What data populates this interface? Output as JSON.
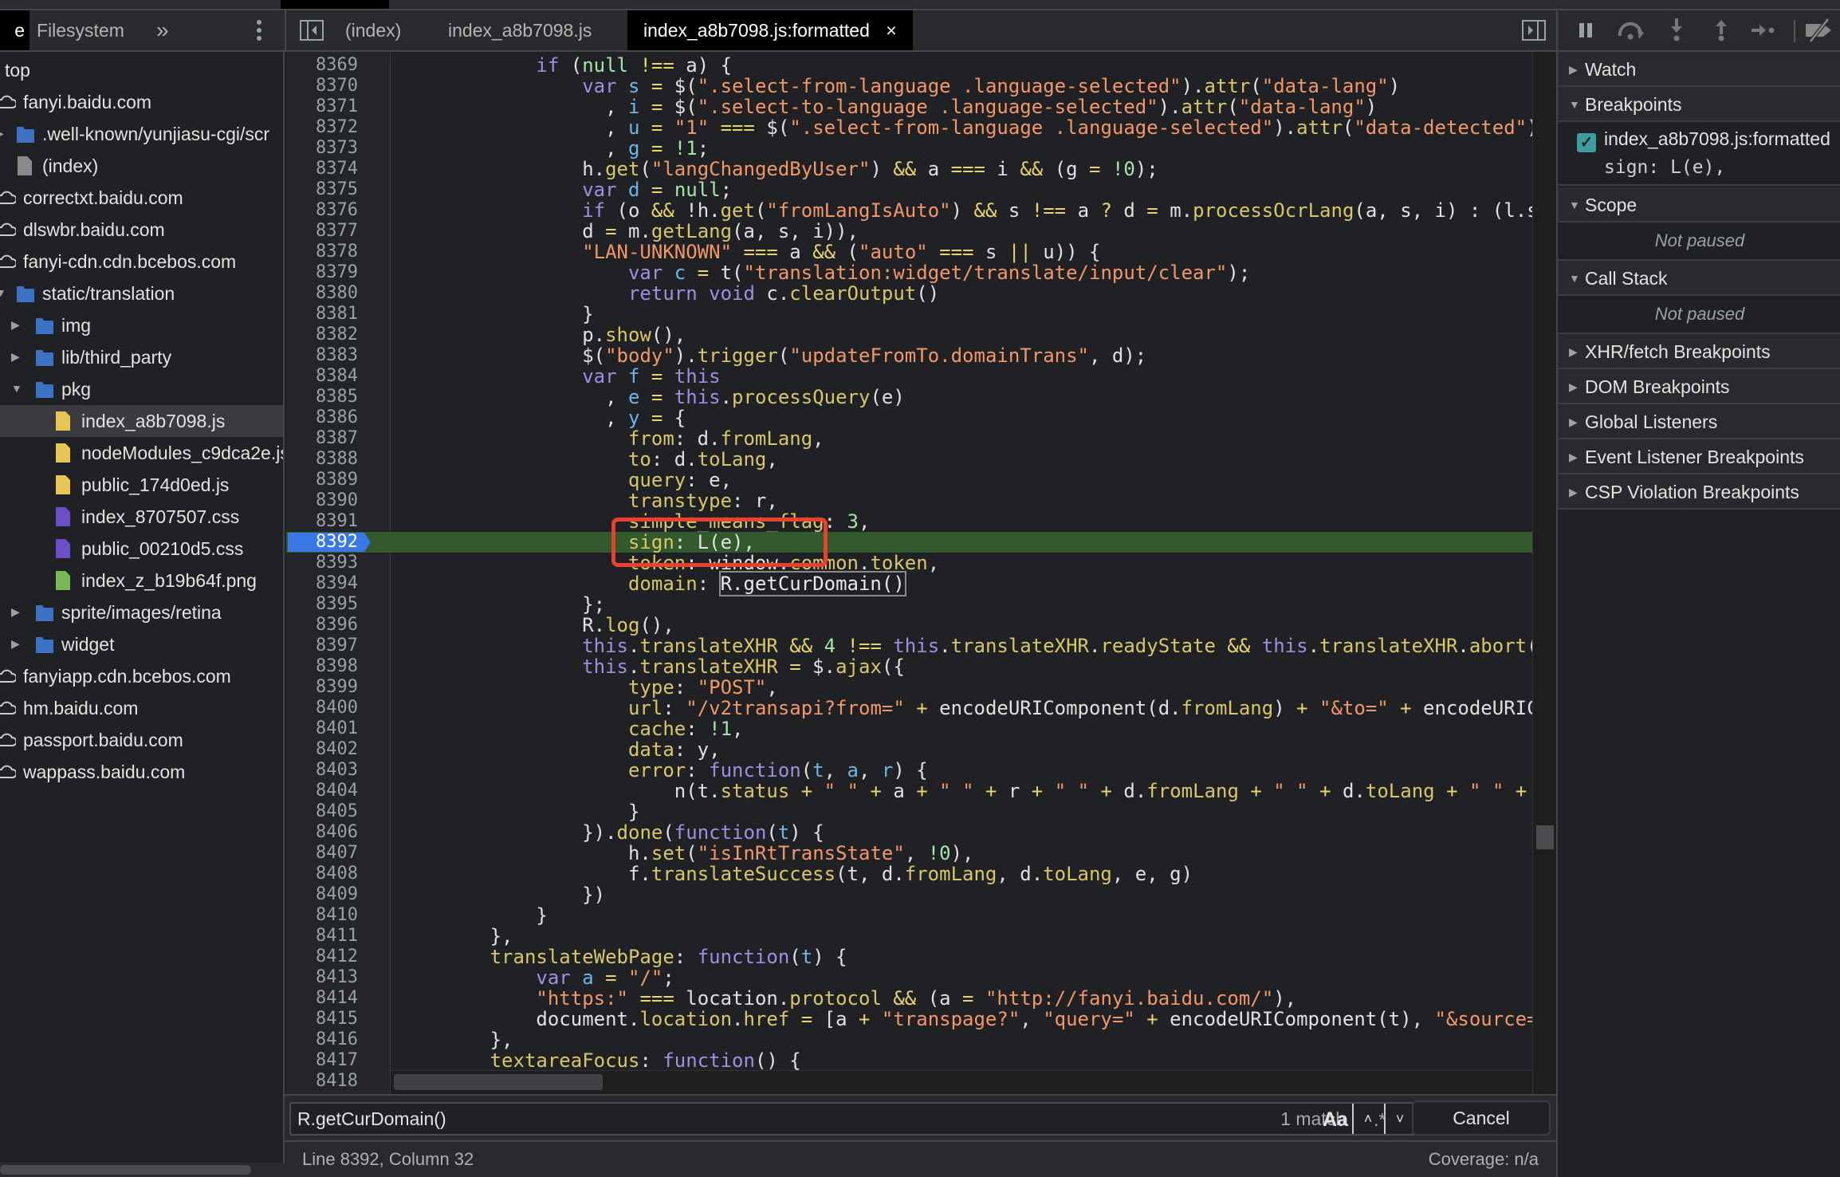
{
  "left_tabs": {
    "cut_tab": "e",
    "filesystem": "Filesystem",
    "more": "»"
  },
  "editor_tabs": [
    {
      "label": "(index)",
      "active": false
    },
    {
      "label": "index_a8b7098.js",
      "active": false
    },
    {
      "label": "index_a8b7098.js:formatted",
      "active": true,
      "close": "×"
    }
  ],
  "tree": [
    {
      "label": "top",
      "depth": 0,
      "icon": "none"
    },
    {
      "label": "fanyi.baidu.com",
      "depth": 1,
      "icon": "cloud"
    },
    {
      "label": ".well-known/yunjiasu-cgi/scr",
      "depth": 2,
      "icon": "folder",
      "arrow": "right"
    },
    {
      "label": "(index)",
      "depth": 2,
      "icon": "file-gray"
    },
    {
      "label": "correctxt.baidu.com",
      "depth": 1,
      "icon": "cloud"
    },
    {
      "label": "dlswbr.baidu.com",
      "depth": 1,
      "icon": "cloud"
    },
    {
      "label": "fanyi-cdn.cdn.bcebos.com",
      "depth": 1,
      "icon": "cloud"
    },
    {
      "label": "static/translation",
      "depth": 2,
      "icon": "folder",
      "arrow": "down"
    },
    {
      "label": "img",
      "depth": 3,
      "icon": "folder",
      "arrow": "right"
    },
    {
      "label": "lib/third_party",
      "depth": 3,
      "icon": "folder",
      "arrow": "right"
    },
    {
      "label": "pkg",
      "depth": 3,
      "icon": "folder",
      "arrow": "down"
    },
    {
      "label": "index_a8b7098.js",
      "depth": 4,
      "icon": "file-js",
      "selected": true
    },
    {
      "label": "nodeModules_c9dca2e.js",
      "depth": 4,
      "icon": "file-js"
    },
    {
      "label": "public_174d0ed.js",
      "depth": 4,
      "icon": "file-js"
    },
    {
      "label": "index_8707507.css",
      "depth": 4,
      "icon": "file-css"
    },
    {
      "label": "public_00210d5.css",
      "depth": 4,
      "icon": "file-css"
    },
    {
      "label": "index_z_b19b64f.png",
      "depth": 4,
      "icon": "file-img"
    },
    {
      "label": "sprite/images/retina",
      "depth": 3,
      "icon": "folder",
      "arrow": "right"
    },
    {
      "label": "widget",
      "depth": 3,
      "icon": "folder",
      "arrow": "right"
    },
    {
      "label": "fanyiapp.cdn.bcebos.com",
      "depth": 1,
      "icon": "cloud"
    },
    {
      "label": "hm.baidu.com",
      "depth": 1,
      "icon": "cloud"
    },
    {
      "label": "passport.baidu.com",
      "depth": 1,
      "icon": "cloud"
    },
    {
      "label": "wappass.baidu.com",
      "depth": 1,
      "icon": "cloud"
    }
  ],
  "colors": {
    "folder": "#3b72c4",
    "file-js": "#e6c553",
    "file-css": "#6a4fc8",
    "file-img": "#7bb65a",
    "file-gray": "#8a8a8a",
    "breakpoint_line": "#335a2c",
    "annotation": "#e8412c"
  },
  "breakpoint_line": "8392",
  "code": [
    {
      "n": "8369",
      "t": [
        "            ",
        [
          "k",
          "if"
        ],
        " (",
        [
          "n",
          "null"
        ],
        " ",
        [
          "o",
          "!=="
        ],
        " a) {"
      ]
    },
    {
      "n": "8370",
      "t": [
        "                ",
        [
          "k",
          "var"
        ],
        " ",
        [
          "v",
          "s"
        ],
        " ",
        [
          "o",
          "="
        ],
        " $(",
        [
          "s",
          "\".select-from-language .language-selected\""
        ],
        ").",
        [
          "p",
          "attr"
        ],
        "(",
        [
          "s",
          "\"data-lang\""
        ],
        ")"
      ]
    },
    {
      "n": "8371",
      "t": [
        "                  , ",
        [
          "v",
          "i"
        ],
        " ",
        [
          "o",
          "="
        ],
        " $(",
        [
          "s",
          "\".select-to-language .language-selected\""
        ],
        ").",
        [
          "p",
          "attr"
        ],
        "(",
        [
          "s",
          "\"data-lang\""
        ],
        ")"
      ]
    },
    {
      "n": "8372",
      "t": [
        "                  , ",
        [
          "v",
          "u"
        ],
        " ",
        [
          "o",
          "="
        ],
        " ",
        [
          "s",
          "\"1\""
        ],
        " ",
        [
          "o",
          "==="
        ],
        " $(",
        [
          "s",
          "\".select-from-language .language-selected\""
        ],
        ").",
        [
          "p",
          "attr"
        ],
        "(",
        [
          "s",
          "\"data-detected\""
        ],
        ")"
      ]
    },
    {
      "n": "8373",
      "t": [
        "                  , ",
        [
          "v",
          "g"
        ],
        " ",
        [
          "o",
          "="
        ],
        " ",
        [
          "n",
          "!1"
        ],
        ";"
      ]
    },
    {
      "n": "8374",
      "t": [
        "                h.",
        [
          "p",
          "get"
        ],
        "(",
        [
          "s",
          "\"langChangedByUser\""
        ],
        ") ",
        [
          "o",
          "&&"
        ],
        " a ",
        [
          "o",
          "==="
        ],
        " i ",
        [
          "o",
          "&&"
        ],
        " (g ",
        [
          "o",
          "="
        ],
        " ",
        [
          "n",
          "!0"
        ],
        ");"
      ]
    },
    {
      "n": "8375",
      "t": [
        "                ",
        [
          "k",
          "var"
        ],
        " ",
        [
          "v",
          "d"
        ],
        " ",
        [
          "o",
          "="
        ],
        " ",
        [
          "n",
          "null"
        ],
        ";"
      ]
    },
    {
      "n": "8376",
      "t": [
        "                ",
        [
          "k",
          "if"
        ],
        " (o ",
        [
          "o",
          "&&"
        ],
        " !h.",
        [
          "p",
          "get"
        ],
        "(",
        [
          "s",
          "\"fromLangIsAuto\""
        ],
        ") ",
        [
          "o",
          "&&"
        ],
        " s ",
        [
          "o",
          "!=="
        ],
        " a ",
        [
          "o",
          "?"
        ],
        " d ",
        [
          "o",
          "="
        ],
        " m.",
        [
          "p",
          "processOcrLang"
        ],
        "(a, s, i) : (l.s"
      ]
    },
    {
      "n": "8377",
      "t": [
        "                d ",
        [
          "o",
          "="
        ],
        " m.",
        [
          "p",
          "getLang"
        ],
        "(a, s, i)),"
      ]
    },
    {
      "n": "8378",
      "t": [
        "                ",
        [
          "s",
          "\"LAN-UNKNOWN\""
        ],
        " ",
        [
          "o",
          "==="
        ],
        " a ",
        [
          "o",
          "&&"
        ],
        " (",
        [
          "s",
          "\"auto\""
        ],
        " ",
        [
          "o",
          "==="
        ],
        " s ",
        [
          "o",
          "||"
        ],
        " u)) {"
      ]
    },
    {
      "n": "8379",
      "t": [
        "                    ",
        [
          "k",
          "var"
        ],
        " ",
        [
          "v",
          "c"
        ],
        " ",
        [
          "o",
          "="
        ],
        " t(",
        [
          "s",
          "\"translation:widget/translate/input/clear\""
        ],
        ");"
      ]
    },
    {
      "n": "8380",
      "t": [
        "                    ",
        [
          "k",
          "return"
        ],
        " ",
        [
          "k",
          "void"
        ],
        " c.",
        [
          "p",
          "clearOutput"
        ],
        "()"
      ]
    },
    {
      "n": "8381",
      "t": [
        "                }"
      ]
    },
    {
      "n": "8382",
      "t": [
        "                p.",
        [
          "p",
          "show"
        ],
        "(),"
      ]
    },
    {
      "n": "8383",
      "t": [
        "                $(",
        [
          "s",
          "\"body\""
        ],
        ").",
        [
          "p",
          "trigger"
        ],
        "(",
        [
          "s",
          "\"updateFromTo.domainTrans\""
        ],
        ", d);"
      ]
    },
    {
      "n": "8384",
      "t": [
        "                ",
        [
          "k",
          "var"
        ],
        " ",
        [
          "v",
          "f"
        ],
        " ",
        [
          "o",
          "="
        ],
        " ",
        [
          "k",
          "this"
        ]
      ]
    },
    {
      "n": "8385",
      "t": [
        "                  , ",
        [
          "v",
          "e"
        ],
        " ",
        [
          "o",
          "="
        ],
        " ",
        [
          "k",
          "this"
        ],
        ".",
        [
          "p",
          "processQuery"
        ],
        "(e)"
      ]
    },
    {
      "n": "8386",
      "t": [
        "                  , ",
        [
          "v",
          "y"
        ],
        " ",
        [
          "o",
          "="
        ],
        " {"
      ]
    },
    {
      "n": "8387",
      "t": [
        "                    ",
        [
          "p",
          "from"
        ],
        ": d.",
        [
          "p",
          "fromLang"
        ],
        ","
      ]
    },
    {
      "n": "8388",
      "t": [
        "                    ",
        [
          "p",
          "to"
        ],
        ": d.",
        [
          "p",
          "toLang"
        ],
        ","
      ]
    },
    {
      "n": "8389",
      "t": [
        "                    ",
        [
          "p",
          "query"
        ],
        ": e,"
      ]
    },
    {
      "n": "8390",
      "t": [
        "                    ",
        [
          "p",
          "transtype"
        ],
        ": r,"
      ]
    },
    {
      "n": "8391",
      "t": [
        "                    ",
        [
          "p",
          "simple_means_flag"
        ],
        ": ",
        [
          "n",
          "3"
        ],
        ","
      ]
    },
    {
      "n": "8392",
      "t": [
        "                    ",
        [
          "p",
          "sign"
        ],
        ": L(e),"
      ]
    },
    {
      "n": "8393",
      "t": [
        "                    ",
        [
          "p",
          "token"
        ],
        ": window.",
        [
          "p",
          "common"
        ],
        ".",
        [
          "p",
          "token"
        ],
        ","
      ]
    },
    {
      "n": "8394",
      "t": [
        "                    ",
        [
          "p",
          "domain"
        ],
        ": ",
        [
          "m",
          "R.getCurDomain()"
        ]
      ]
    },
    {
      "n": "8395",
      "t": [
        "                };"
      ]
    },
    {
      "n": "8396",
      "t": [
        "                R.",
        [
          "p",
          "log"
        ],
        "(),"
      ]
    },
    {
      "n": "8397",
      "t": [
        "                ",
        [
          "k",
          "this"
        ],
        ".",
        [
          "p",
          "translateXHR"
        ],
        " ",
        [
          "o",
          "&&"
        ],
        " ",
        [
          "n",
          "4"
        ],
        " ",
        [
          "o",
          "!=="
        ],
        " ",
        [
          "k",
          "this"
        ],
        ".",
        [
          "p",
          "translateXHR"
        ],
        ".",
        [
          "p",
          "readyState"
        ],
        " ",
        [
          "o",
          "&&"
        ],
        " ",
        [
          "k",
          "this"
        ],
        ".",
        [
          "p",
          "translateXHR"
        ],
        ".",
        [
          "p",
          "abort"
        ],
        "("
      ]
    },
    {
      "n": "8398",
      "t": [
        "                ",
        [
          "k",
          "this"
        ],
        ".",
        [
          "p",
          "translateXHR"
        ],
        " ",
        [
          "o",
          "="
        ],
        " $.",
        [
          "p",
          "ajax"
        ],
        "({"
      ]
    },
    {
      "n": "8399",
      "t": [
        "                    ",
        [
          "p",
          "type"
        ],
        ": ",
        [
          "s",
          "\"POST\""
        ],
        ","
      ]
    },
    {
      "n": "8400",
      "t": [
        "                    ",
        [
          "p",
          "url"
        ],
        ": ",
        [
          "s",
          "\"/v2transapi?from=\""
        ],
        " ",
        [
          "o",
          "+"
        ],
        " encodeURIComponent(d.",
        [
          "p",
          "fromLang"
        ],
        ") ",
        [
          "o",
          "+"
        ],
        " ",
        [
          "s",
          "\"&to=\""
        ],
        " ",
        [
          "o",
          "+"
        ],
        " encodeURIC"
      ]
    },
    {
      "n": "8401",
      "t": [
        "                    ",
        [
          "p",
          "cache"
        ],
        ": ",
        [
          "n",
          "!1"
        ],
        ","
      ]
    },
    {
      "n": "8402",
      "t": [
        "                    ",
        [
          "p",
          "data"
        ],
        ": y,"
      ]
    },
    {
      "n": "8403",
      "t": [
        "                    ",
        [
          "p",
          "error"
        ],
        ": ",
        [
          "k",
          "function"
        ],
        "(",
        [
          "v",
          "t"
        ],
        ", ",
        [
          "v",
          "a"
        ],
        ", ",
        [
          "v",
          "r"
        ],
        ") {"
      ]
    },
    {
      "n": "8404",
      "t": [
        "                        n(t.",
        [
          "p",
          "status"
        ],
        " ",
        [
          "o",
          "+"
        ],
        " ",
        [
          "s",
          "\" \""
        ],
        " ",
        [
          "o",
          "+"
        ],
        " a ",
        [
          "o",
          "+"
        ],
        " ",
        [
          "s",
          "\" \""
        ],
        " ",
        [
          "o",
          "+"
        ],
        " r ",
        [
          "o",
          "+"
        ],
        " ",
        [
          "s",
          "\" \""
        ],
        " ",
        [
          "o",
          "+"
        ],
        " d.",
        [
          "p",
          "fromLang"
        ],
        " ",
        [
          "o",
          "+"
        ],
        " ",
        [
          "s",
          "\" \""
        ],
        " ",
        [
          "o",
          "+"
        ],
        " d.",
        [
          "p",
          "toLang"
        ],
        " ",
        [
          "o",
          "+"
        ],
        " ",
        [
          "s",
          "\" \""
        ],
        " ",
        [
          "o",
          "+"
        ]
      ]
    },
    {
      "n": "8405",
      "t": [
        "                    }"
      ]
    },
    {
      "n": "8406",
      "t": [
        "                }).",
        [
          "p",
          "done"
        ],
        "(",
        [
          "k",
          "function"
        ],
        "(",
        [
          "v",
          "t"
        ],
        ") {"
      ]
    },
    {
      "n": "8407",
      "t": [
        "                    h.",
        [
          "p",
          "set"
        ],
        "(",
        [
          "s",
          "\"isInRtTransState\""
        ],
        ", ",
        [
          "n",
          "!0"
        ],
        "),"
      ]
    },
    {
      "n": "8408",
      "t": [
        "                    f.",
        [
          "p",
          "translateSuccess"
        ],
        "(t, d.",
        [
          "p",
          "fromLang"
        ],
        ", d.",
        [
          "p",
          "toLang"
        ],
        ", e, g)"
      ]
    },
    {
      "n": "8409",
      "t": [
        "                })"
      ]
    },
    {
      "n": "8410",
      "t": [
        "            }"
      ]
    },
    {
      "n": "8411",
      "t": [
        "        },"
      ]
    },
    {
      "n": "8412",
      "t": [
        "        ",
        [
          "p",
          "translateWebPage"
        ],
        ": ",
        [
          "k",
          "function"
        ],
        "(",
        [
          "v",
          "t"
        ],
        ") {"
      ]
    },
    {
      "n": "8413",
      "t": [
        "            ",
        [
          "k",
          "var"
        ],
        " ",
        [
          "v",
          "a"
        ],
        " ",
        [
          "o",
          "="
        ],
        " ",
        [
          "s",
          "\"/\""
        ],
        ";"
      ]
    },
    {
      "n": "8414",
      "t": [
        "            ",
        [
          "s",
          "\"https:\""
        ],
        " ",
        [
          "o",
          "==="
        ],
        " location.",
        [
          "p",
          "protocol"
        ],
        " ",
        [
          "o",
          "&&"
        ],
        " (a ",
        [
          "o",
          "="
        ],
        " ",
        [
          "s",
          "\"http://fanyi.baidu.com/\""
        ],
        "),"
      ]
    },
    {
      "n": "8415",
      "t": [
        "            document.",
        [
          "p",
          "location"
        ],
        ".",
        [
          "p",
          "href"
        ],
        " ",
        [
          "o",
          "="
        ],
        " [a ",
        [
          "o",
          "+"
        ],
        " ",
        [
          "s",
          "\"transpage?\""
        ],
        ", ",
        [
          "s",
          "\"query=\""
        ],
        " ",
        [
          "o",
          "+"
        ],
        " encodeURIComponent(t), ",
        [
          "s",
          "\"&source="
        ]
      ]
    },
    {
      "n": "8416",
      "t": [
        "        },"
      ]
    },
    {
      "n": "8417",
      "t": [
        "        ",
        [
          "p",
          "textareaFocus"
        ],
        ": ",
        [
          "k",
          "function"
        ],
        "() {"
      ]
    },
    {
      "n": "8418",
      "t": [
        ""
      ]
    }
  ],
  "search": {
    "value": "R.getCurDomain()",
    "count": "1 match",
    "up": "˄",
    "down": "˅",
    "case": "Aa",
    "regex": ".*",
    "cancel": "Cancel"
  },
  "status": {
    "position": "Line 8392, Column 32",
    "coverage": "Coverage: n/a"
  },
  "debugger": {
    "sections": [
      {
        "label": "Watch",
        "expanded": false
      },
      {
        "label": "Breakpoints",
        "expanded": true,
        "breakpoint": {
          "file": "index_a8b7098.js:formatted",
          "code": "sign: L(e),",
          "checked": true
        }
      },
      {
        "label": "Scope",
        "expanded": true,
        "body": "Not paused"
      },
      {
        "label": "Call Stack",
        "expanded": true,
        "body": "Not paused"
      },
      {
        "label": "XHR/fetch Breakpoints",
        "expanded": false
      },
      {
        "label": "DOM Breakpoints",
        "expanded": false
      },
      {
        "label": "Global Listeners",
        "expanded": false
      },
      {
        "label": "Event Listener Breakpoints",
        "expanded": false
      },
      {
        "label": "CSP Violation Breakpoints",
        "expanded": false
      }
    ]
  }
}
